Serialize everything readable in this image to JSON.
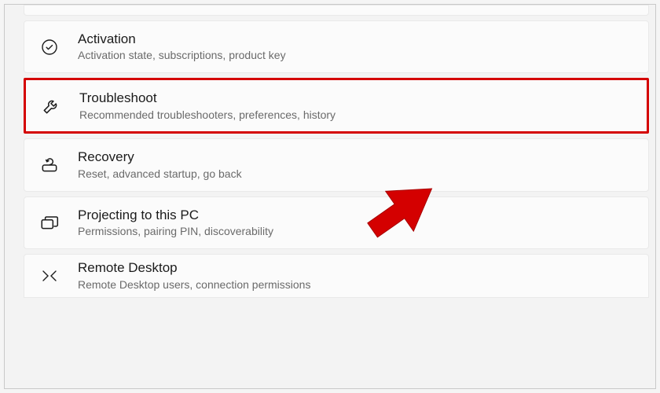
{
  "settings": {
    "items": [
      {
        "icon": "checkmark-circle-icon",
        "title": "Activation",
        "subtitle": "Activation state, subscriptions, product key"
      },
      {
        "icon": "wrench-icon",
        "title": "Troubleshoot",
        "subtitle": "Recommended troubleshooters, preferences, history",
        "highlighted": true
      },
      {
        "icon": "recovery-icon",
        "title": "Recovery",
        "subtitle": "Reset, advanced startup, go back"
      },
      {
        "icon": "project-icon",
        "title": "Projecting to this PC",
        "subtitle": "Permissions, pairing PIN, discoverability"
      },
      {
        "icon": "remote-desktop-icon",
        "title": "Remote Desktop",
        "subtitle": "Remote Desktop users, connection permissions"
      }
    ]
  },
  "annotation": {
    "color": "#d40000"
  }
}
